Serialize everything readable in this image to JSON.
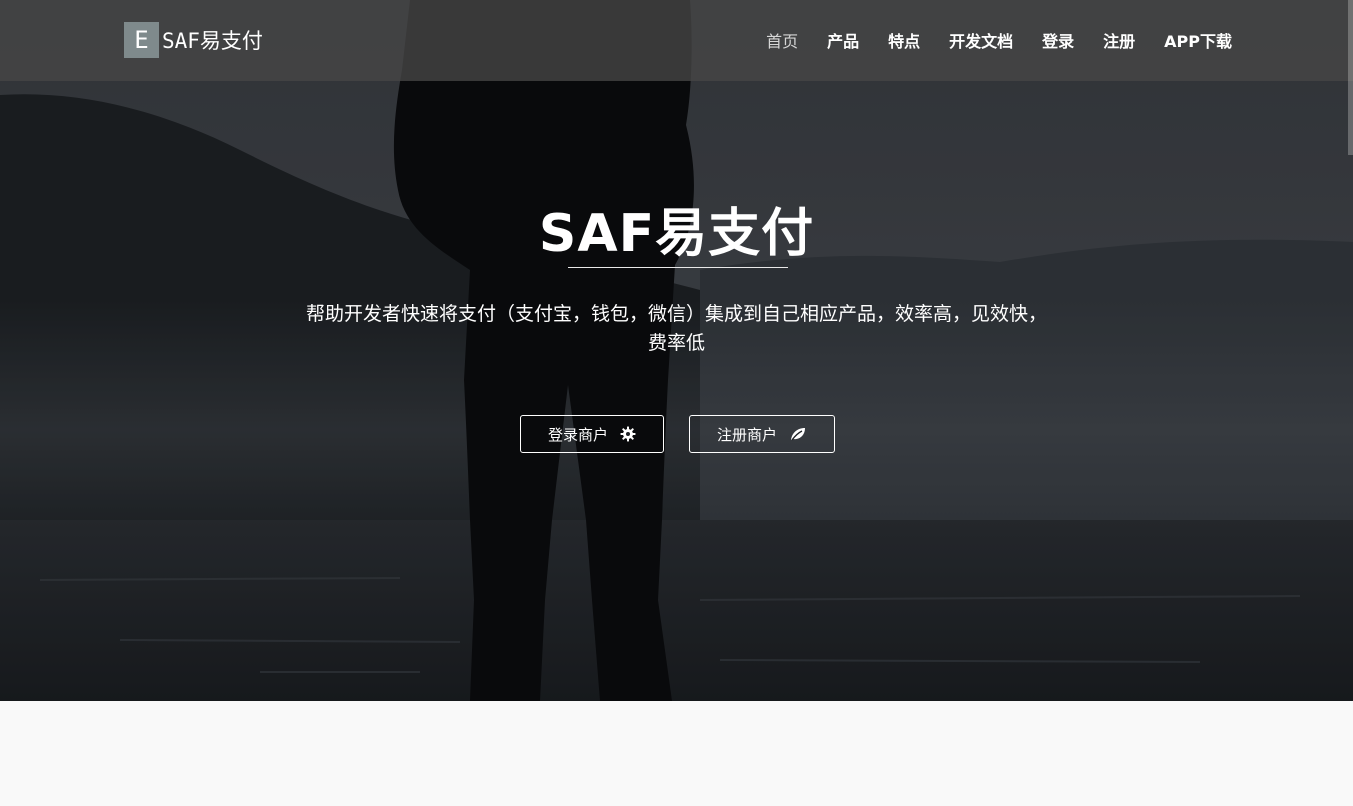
{
  "brand": {
    "logo_letter": "E",
    "name": "SAF易支付"
  },
  "nav": {
    "items": [
      {
        "label": "首页",
        "active": true
      },
      {
        "label": "产品"
      },
      {
        "label": "特点"
      },
      {
        "label": "开发文档"
      },
      {
        "label": "登录"
      },
      {
        "label": "注册"
      },
      {
        "label": "APP下载"
      }
    ]
  },
  "hero": {
    "title": "SAF易支付",
    "subtitle": "帮助开发者快速将支付（支付宝，钱包，微信）集成到自己相应产品，效率高，见效快，费率低",
    "login_button": {
      "label": "登录商户",
      "icon": "gear-icon"
    },
    "register_button": {
      "label": "注册商户",
      "icon": "leaf-icon"
    }
  },
  "colors": {
    "topbar": "#464646",
    "logo_mark": "#7f8a8c",
    "text": "#ffffff",
    "page_background": "#f9f9f9"
  }
}
